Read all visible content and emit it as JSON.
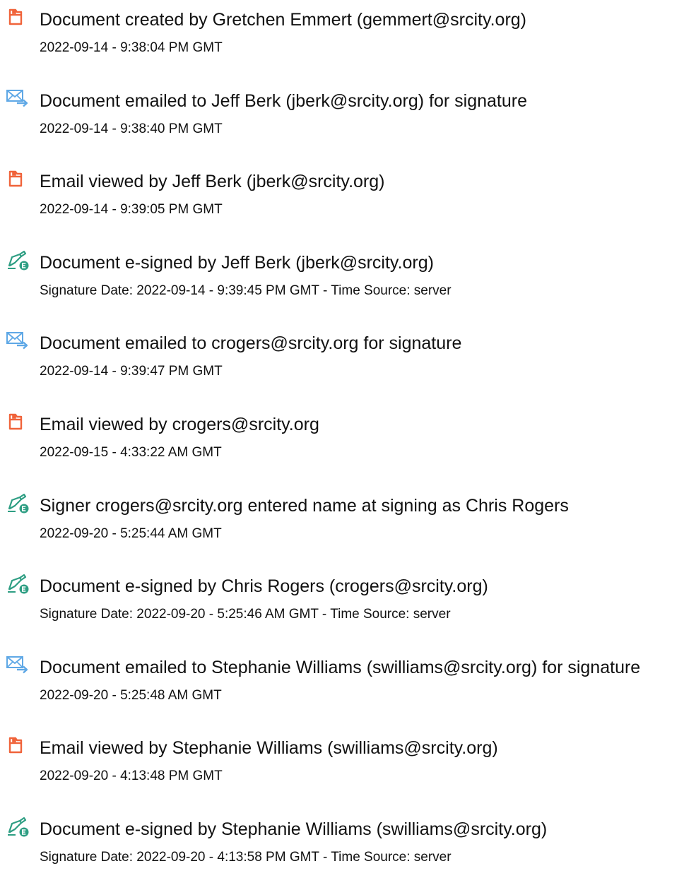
{
  "colors": {
    "document_icon": "#f0633a",
    "email_icon": "#5fa8e6",
    "esign_icon_pen": "#2e9e83",
    "esign_icon_badge": "#2e9e83"
  },
  "events": [
    {
      "icon": "document-icon",
      "title": "Document created by Gretchen Emmert (gemmert@srcity.org)",
      "time": "2022-09-14 - 9:38:04 PM GMT"
    },
    {
      "icon": "email-sent-icon",
      "title": "Document emailed to Jeff Berk (jberk@srcity.org) for signature",
      "time": "2022-09-14 - 9:38:40 PM GMT"
    },
    {
      "icon": "document-icon",
      "title": "Email viewed by Jeff Berk (jberk@srcity.org)",
      "time": "2022-09-14 - 9:39:05 PM GMT"
    },
    {
      "icon": "esign-pen-icon",
      "title": "Document e-signed by Jeff Berk (jberk@srcity.org)",
      "time": "Signature Date: 2022-09-14 - 9:39:45 PM GMT - Time Source: server"
    },
    {
      "icon": "email-sent-icon",
      "title": "Document emailed to crogers@srcity.org for signature",
      "time": "2022-09-14 - 9:39:47 PM GMT"
    },
    {
      "icon": "document-icon",
      "title": "Email viewed by crogers@srcity.org",
      "time": "2022-09-15 - 4:33:22 AM GMT"
    },
    {
      "icon": "esign-pen-icon",
      "title": "Signer crogers@srcity.org entered name at signing as Chris Rogers",
      "time": "2022-09-20 - 5:25:44 AM GMT"
    },
    {
      "icon": "esign-pen-icon",
      "title": "Document e-signed by Chris Rogers (crogers@srcity.org)",
      "time": "Signature Date: 2022-09-20 - 5:25:46 AM GMT - Time Source: server"
    },
    {
      "icon": "email-sent-icon",
      "title": "Document emailed to Stephanie Williams (swilliams@srcity.org) for signature",
      "time": "2022-09-20 - 5:25:48 AM GMT"
    },
    {
      "icon": "document-icon",
      "title": "Email viewed by Stephanie Williams (swilliams@srcity.org)",
      "time": "2022-09-20 - 4:13:48 PM GMT"
    },
    {
      "icon": "esign-pen-icon",
      "title": "Document e-signed by Stephanie Williams (swilliams@srcity.org)",
      "time": "Signature Date: 2022-09-20 - 4:13:58 PM GMT - Time Source: server"
    }
  ]
}
